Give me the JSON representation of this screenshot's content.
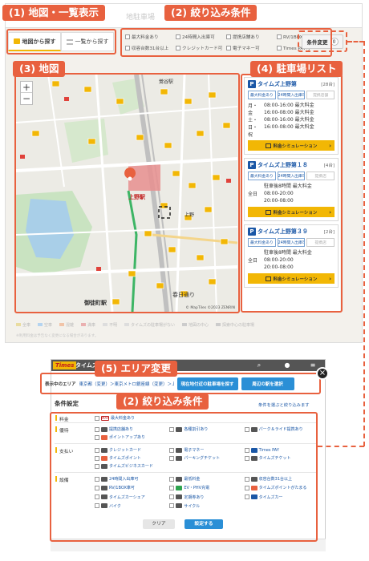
{
  "annotations": {
    "a1": "(1) 地図・一覧表示",
    "a2": "(2) 絞り込み条件",
    "a3": "(3) 地図",
    "a4": "(4) 駐車場リスト",
    "a5": "(5) エリア変更",
    "a6": "(2) 絞り込み条件"
  },
  "header": {
    "ghost_title": "地駐車場"
  },
  "view_tabs": [
    {
      "label": "地図から探す",
      "icon": "map-square-icon",
      "active": true
    },
    {
      "label": "一覧から探す",
      "icon": "list-icon",
      "active": false
    }
  ],
  "filters": [
    "最大料金あり",
    "24時間入出庫可",
    "提携店舗あり",
    "RV/1BOX車可",
    "収容台数31台以上",
    "クレジットカード可",
    "電子マネー可",
    "Times PAY可"
  ],
  "change_button": {
    "label": "条件変更",
    "count": "0"
  },
  "map": {
    "zoom_in": "+",
    "zoom_out": "−",
    "copyright": "© MapTiles ©2023 ZENRIN",
    "labels": [
      "鶯谷駅",
      "上野駅",
      "上野",
      "春日通り",
      "御徒町駅"
    ]
  },
  "parking_list": [
    {
      "name": "タイムズ上野第",
      "count": "[28台]",
      "tags": [
        "最大料金あり",
        "24時間入出庫可",
        "提携店舗"
      ],
      "days": [
        "月・金",
        "土・日・祝"
      ],
      "times": [
        "08:00-16:00 最大料金",
        "16:00-08:00 最大料金",
        "08:00-16:00 最大料金",
        "16:00-08:00 最大料金"
      ],
      "sim": "料金シミュレーション"
    },
    {
      "name": "タイムズ上野第１８",
      "count": "[4台]",
      "tags": [
        "最大料金あり",
        "24時間入出庫可",
        "提携店"
      ],
      "days": [
        "全日"
      ],
      "times": [
        "駐車後8時間 最大料金",
        "08:00-20:00",
        "20:00-08:00"
      ],
      "sim": "料金シミュレーション"
    },
    {
      "name": "タイムズ上野第３９",
      "count": "[2台]",
      "tags": [
        "最大料金あり",
        "24時間入出庫可",
        "提携店"
      ],
      "days": [
        "全日"
      ],
      "times": [
        "駐車後8時間 最大料金",
        "08:00-20:00",
        "20:00-08:00"
      ],
      "sim": "料金シミュレーション"
    }
  ],
  "legend": [
    "全車",
    "空車",
    "混雑",
    "満車",
    "不明",
    "タイムズの駐車場がない",
    "地図の中心",
    "探索中心の駐車場"
  ],
  "note": "※利用料金は予告なく変更になる場合があります。",
  "modal": {
    "top_bar": {
      "brand": "Times",
      "brand_text": "タイムズの駐"
    },
    "area": {
      "label": "表示中のエリア",
      "path": "東京都（変更）＞東京メトロ銀座線（変更）＞上野駅（変更）",
      "btn_near": "現在地付近の駐車場を探す",
      "btn_select": "周辺の駅を選択"
    },
    "cond_title": "条件設定",
    "cond_hint": "条件を選ぶと絞り込みます",
    "rows": [
      {
        "cat": "料金",
        "opts": [
          {
            "label": "最大料金あり",
            "icon": "max-badge-icon"
          }
        ]
      },
      {
        "cat": "優待",
        "opts": [
          {
            "label": "提携店舗あり",
            "icon": "shop-icon"
          },
          {
            "label": "各種割引あり",
            "icon": "discount-icon"
          },
          {
            "label": "パーク＆ライド提携あり",
            "icon": "train-icon"
          },
          {
            "label": "ポイントアップあり",
            "icon": "point-icon"
          }
        ]
      },
      {
        "cat": "支払い",
        "opts": [
          {
            "label": "クレジットカード",
            "icon": "card-icon"
          },
          {
            "label": "電子マネー",
            "icon": "emoney-icon"
          },
          {
            "label": "Times PAY",
            "icon": "timespay-icon"
          },
          {
            "label": "タイムズポイント",
            "icon": "tpoint-icon"
          },
          {
            "label": "パーキングチケット",
            "icon": "ticket-icon"
          },
          {
            "label": "タイムズチケット",
            "icon": "tticket-icon"
          },
          {
            "label": "タイムズビジネスカード",
            "icon": "bizcard-icon"
          }
        ]
      },
      {
        "cat": "設備",
        "opts": [
          {
            "label": "24時間入出庫可",
            "icon": "clock-icon"
          },
          {
            "label": "最低料金",
            "icon": "yen-icon"
          },
          {
            "label": "収容台数31台以上",
            "icon": "capacity-icon"
          },
          {
            "label": "RV/1BOX車可",
            "icon": "rv-icon"
          },
          {
            "label": "EV・PHV充電",
            "icon": "ev-icon"
          },
          {
            "label": "タイムズポイントがたまる",
            "icon": "tp-icon"
          },
          {
            "label": "タイムズカーシェア",
            "icon": "carshare-icon"
          },
          {
            "label": "定期券あり",
            "icon": "pass-icon"
          },
          {
            "label": "タイムズカー",
            "icon": "car-icon"
          },
          {
            "label": "バイク",
            "icon": "bike-icon"
          },
          {
            "label": "サイクル",
            "icon": "cycle-icon"
          }
        ]
      }
    ],
    "btn_clear": "クリア",
    "btn_set": "設定する"
  },
  "colors": {
    "accent": "#e8613f",
    "brand_yellow": "#f2b705",
    "link_blue": "#1a57a6",
    "button_blue": "#2a8fd6"
  }
}
